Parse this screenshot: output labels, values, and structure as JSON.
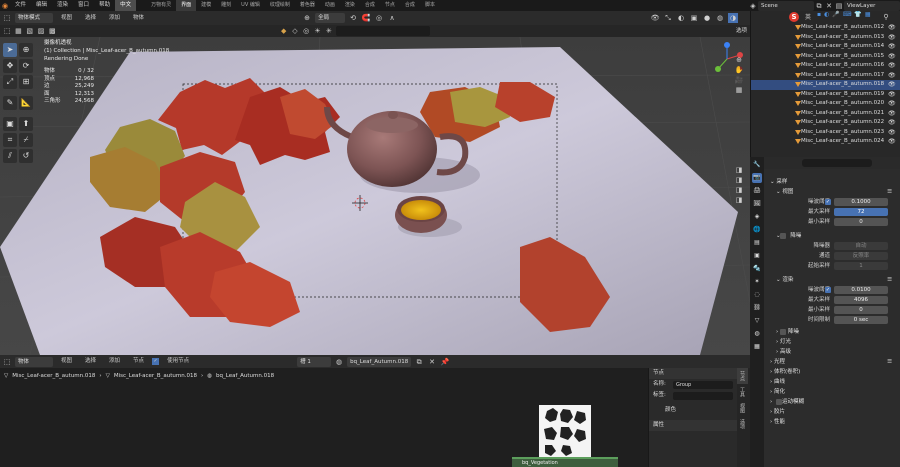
{
  "topbar": {
    "menus": [
      "文件",
      "编辑",
      "渲染",
      "窗口",
      "帮助"
    ],
    "lang_btn": "中文",
    "workspaces": [
      "万物有灵",
      "界面",
      "建模",
      "雕刻",
      "UV 编辑",
      "纹理绘制",
      "着色器",
      "动画",
      "渲染",
      "合成",
      "节点",
      "合成",
      "脚本"
    ],
    "scene_label": "Scene",
    "viewlayer_label": "ViewLayer"
  },
  "viewport_header": {
    "mode": "物体模式",
    "menus": [
      "视图",
      "选择",
      "添加",
      "物体"
    ],
    "orientation": "全局",
    "view_label": "选项"
  },
  "viewport_overlay": {
    "title": "摄像机透视",
    "subtitle": "(1) Collection | Misc_Leaf-acer_B_autumn.018",
    "status": "Rendering Done",
    "stats": [
      {
        "k": "物体",
        "v": "0 / 32"
      },
      {
        "k": "顶点",
        "v": "12,968"
      },
      {
        "k": "边",
        "v": "25,249"
      },
      {
        "k": "面",
        "v": "12,313"
      },
      {
        "k": "三角形",
        "v": "24,568"
      }
    ]
  },
  "node_header": {
    "type": "物体",
    "menus": [
      "视图",
      "选择",
      "添加",
      "节点"
    ],
    "use_nodes": "使用节点",
    "slot": "槽 1",
    "material": "bq_Leaf_Autumn.018"
  },
  "node_breadcrumb": [
    "Misc_Leaf-acer_B_autumn.018",
    "Misc_Leaf-acer_B_autumn.018",
    "bq_Leaf_Autumn.018"
  ],
  "node_panel": {
    "section": "节点",
    "name_label": "名称:",
    "name_value": "Group",
    "label_label": "标签:",
    "color_label": "颜色",
    "props_label": "属性"
  },
  "node_tabs": [
    "节点",
    "工具",
    "视图",
    "选项"
  ],
  "node_group_label": "bq_Vegetation",
  "outliner": {
    "items": [
      "Misc_Leaf-acer_B_autumn.012",
      "Misc_Leaf-acer_B_autumn.013",
      "Misc_Leaf-acer_B_autumn.014",
      "Misc_Leaf-acer_B_autumn.015",
      "Misc_Leaf-acer_B_autumn.016",
      "Misc_Leaf-acer_B_autumn.017",
      "Misc_Leaf-acer_B_autumn.018",
      "Misc_Leaf-acer_B_autumn.019",
      "Misc_Leaf-acer_B_autumn.020",
      "Misc_Leaf-acer_B_autumn.021",
      "Misc_Leaf-acer_B_autumn.022",
      "Misc_Leaf-acer_B_autumn.023",
      "Misc_Leaf-acer_B_autumn.024"
    ],
    "ime": "英"
  },
  "properties": {
    "sampling": "采样",
    "viewport": "视图",
    "noise_threshold": "噪波阈值",
    "noise_val_vp": "0.1000",
    "max_samples": "最大采样",
    "max_val_vp": "72",
    "min_samples": "最小采样",
    "min_val_vp": "0",
    "denoise": "降噪",
    "denoiser": "降噪器",
    "denoiser_val": "自动",
    "passes": "通道",
    "passes_val": "反照率",
    "start_sample": "起始采样",
    "start_val": "1",
    "render": "渲染",
    "noise_val_r": "0.0100",
    "max_val_r": "4096",
    "min_val_r": "0",
    "time_limit": "时间限制",
    "time_val": "0 sec",
    "denoise2": "降噪",
    "lights": "灯光",
    "advanced": "高级",
    "light_paths": "光程",
    "volumes": "体积(卷积)",
    "curves": "曲线",
    "simplify": "简化",
    "motion_blur": "运动模糊",
    "film": "胶片",
    "performance": "性能"
  }
}
